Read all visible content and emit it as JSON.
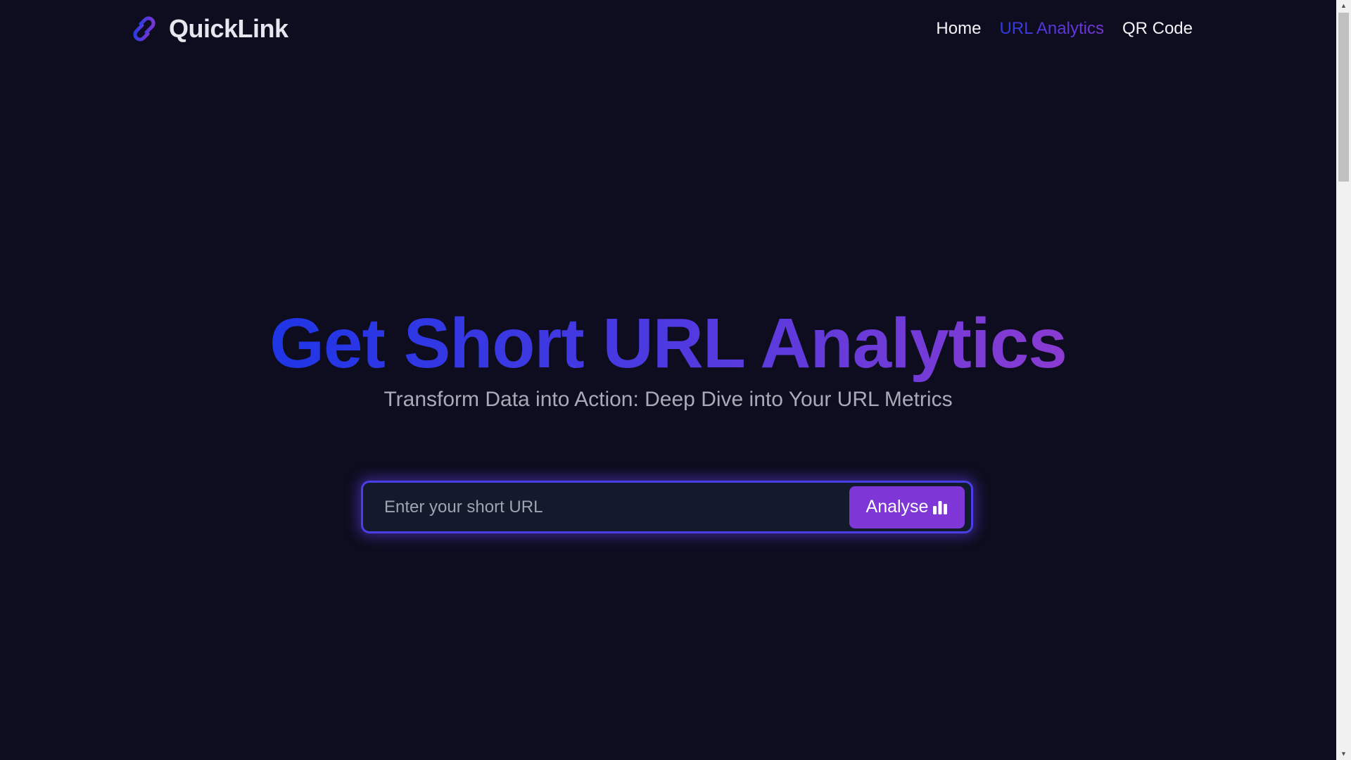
{
  "app": {
    "brand_name": "QuickLink",
    "brand_icon": "link-icon",
    "accent_gradient": [
      "#1f35e6",
      "#8a3bd2"
    ]
  },
  "nav": {
    "items": [
      {
        "label": "Home",
        "active": false
      },
      {
        "label": "URL Analytics",
        "active": true
      },
      {
        "label": "QR Code",
        "active": false
      }
    ]
  },
  "hero": {
    "title": "Get Short URL Analytics",
    "subtitle": "Transform Data into Action: Deep Dive into Your URL Metrics"
  },
  "search": {
    "placeholder": "Enter your short URL",
    "value": "",
    "button_label": "Analyse",
    "button_icon": "bar-chart-icon",
    "button_color": "#7e36d6"
  }
}
